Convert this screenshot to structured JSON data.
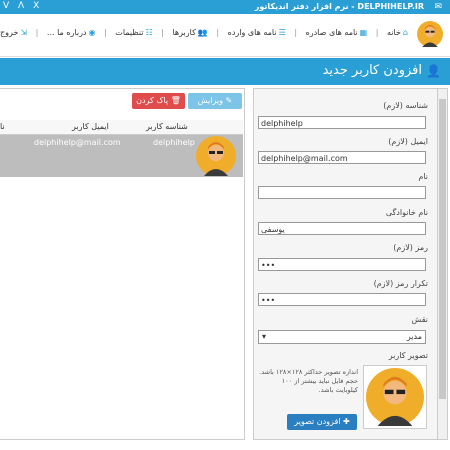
{
  "window": {
    "title": "DELPHIHELP.IR - نرم افزار دفتر اندیکاتور",
    "controls": [
      "ᐯ",
      "ᐱ",
      "X"
    ]
  },
  "menu": {
    "items": [
      {
        "label": "خانه",
        "icon": "home-icon"
      },
      {
        "label": "نامه های صادره",
        "icon": "grid-icon"
      },
      {
        "label": "نامه های وارده",
        "icon": "list-icon"
      },
      {
        "label": "کاربرها",
        "icon": "users-icon"
      },
      {
        "label": "تنظیمات",
        "icon": "settings-icon"
      },
      {
        "label": "درباره ما ...",
        "icon": "info-icon"
      },
      {
        "label": "خروج",
        "icon": "exit-icon"
      }
    ]
  },
  "header": {
    "title": "افزودن کاربر جدید",
    "icon": "add-user-icon"
  },
  "toolbar": {
    "edit_label": "ویرایش",
    "delete_label": "پاک کردن"
  },
  "table": {
    "columns": [
      "شناسه کاربر",
      "ایمیل کاربر",
      "نا"
    ],
    "rows": [
      {
        "username": "delphihelp",
        "email": "delphihelp@mail.com"
      }
    ]
  },
  "form": {
    "username_label": "شناسه (لازم)",
    "username_value": "delphihelp",
    "email_label": "ایمیل (لازم)",
    "email_value": "delphihelp@mail.com",
    "firstname_label": "نام",
    "firstname_value": "",
    "lastname_label": "نام خانوادگی",
    "lastname_value": "یوسفی",
    "password_label": "رمز (لازم)",
    "password_value": "•••",
    "confirm_label": "تکرار رمز (لازم)",
    "confirm_value": "•••",
    "role_label": "نقش",
    "role_value": "مدیر",
    "image_label": "تصویر کاربر",
    "image_note": "اندازه تصویر حداکثر ۱۲۸×۱۲۸ باشد. حجم فایل نباید بیشتر از ۱۰۰ کیلوبایت باشد.",
    "add_image_label": "افزودن تصویر"
  },
  "colors": {
    "accent": "#2a9fd6",
    "delete": "#e04b4b",
    "selected_row": "#bdbdbd"
  }
}
